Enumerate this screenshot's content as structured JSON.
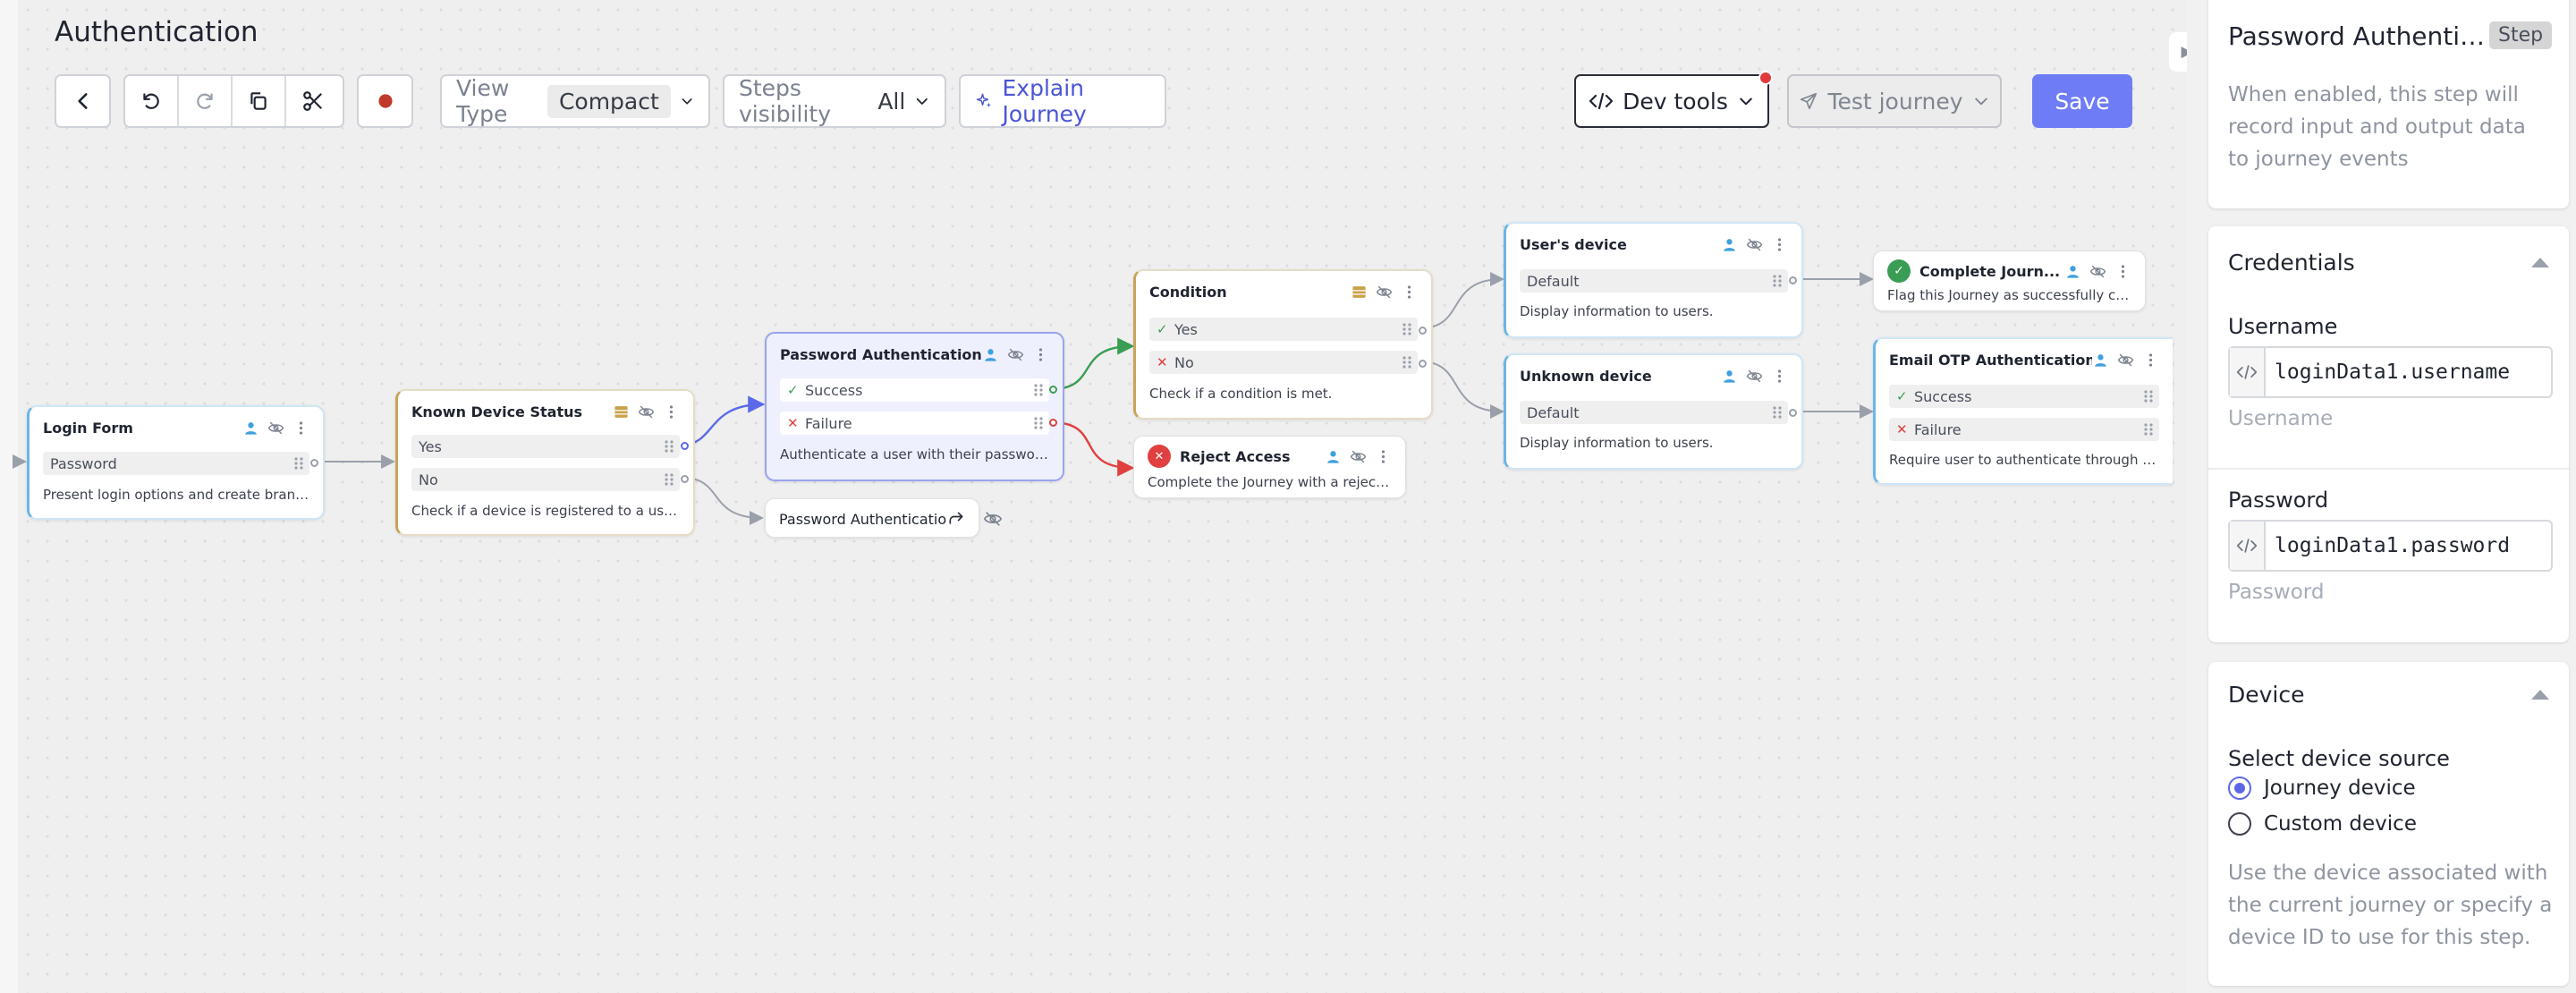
{
  "page": {
    "title": "Authentication"
  },
  "toolbar": {
    "view_type_label": "View Type",
    "view_type_value": "Compact",
    "steps_visibility_label": "Steps visibility",
    "steps_visibility_value": "All",
    "explain_label": "Explain Journey",
    "dev_tools_label": "Dev tools",
    "test_journey_label": "Test journey",
    "save_label": "Save",
    "colors": {
      "accent": "#6e7df5",
      "record": "#c0392b",
      "dev_badge": "#e13b3b"
    }
  },
  "nodes": {
    "login_form": {
      "title": "Login Form",
      "rows": [
        "Password"
      ],
      "desc": "Present login options and create branch..."
    },
    "known_device": {
      "title": "Known Device Status",
      "rows": [
        "Yes",
        "No"
      ],
      "desc": "Check if a device is registered to a user. ..."
    },
    "password_auth": {
      "title": "Password Authentication",
      "rows": [
        "Success",
        "Failure"
      ],
      "desc": "Authenticate a user with their password."
    },
    "password_auth_ref": {
      "title": "Password Authentication"
    },
    "condition": {
      "title": "Condition",
      "rows": [
        "Yes",
        "No"
      ],
      "desc": "Check if a condition is met."
    },
    "reject_access": {
      "title": "Reject Access",
      "desc": "Complete the Journey with a rejecti..."
    },
    "users_device": {
      "title": "User's device",
      "rows": [
        "Default"
      ],
      "desc": "Display information to users."
    },
    "unknown_device": {
      "title": "Unknown device",
      "rows": [
        "Default"
      ],
      "desc": "Display information to users."
    },
    "complete_journey": {
      "title": "Complete Journ...",
      "desc": "Flag this Journey as successfully co..."
    },
    "email_otp": {
      "title": "Email OTP Authentication",
      "rows": [
        "Success",
        "Failure"
      ],
      "desc": "Require user to authenticate through a o..."
    }
  },
  "panel": {
    "title": "Password Authenticat...",
    "badge": "Step",
    "record_help": "When enabled, this step will record input and output data to journey events",
    "credentials": {
      "heading": "Credentials",
      "username_label": "Username",
      "username_value": "loginData1.username",
      "username_placeholder": "Username",
      "password_label": "Password",
      "password_value": "loginData1.password",
      "password_placeholder": "Password"
    },
    "device": {
      "heading": "Device",
      "source_label": "Select device source",
      "option_journey": "Journey device",
      "option_custom": "Custom device",
      "selected": "Journey device",
      "help": "Use the device associated with the current journey or specify a device ID to use for this step."
    }
  }
}
